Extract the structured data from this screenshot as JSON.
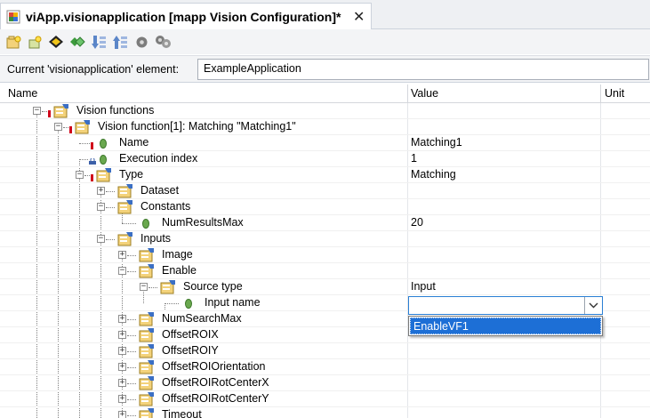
{
  "tab": {
    "title": "viApp.visionapplication [mapp Vision Configuration]*",
    "close_glyph": "✕"
  },
  "toolbar": {
    "buttons": [
      "add-element-icon",
      "add-child-icon",
      "move-icon",
      "link-icon",
      "sort-descending-icon",
      "sort-ascending-icon",
      "settings-icon",
      "multi-settings-icon"
    ]
  },
  "current_element": {
    "label": "Current 'visionapplication' element:",
    "value": "ExampleApplication"
  },
  "grid": {
    "columns": [
      "Name",
      "Value",
      "Unit"
    ],
    "rows": [
      {
        "name": "Vision functions",
        "value": ""
      },
      {
        "name": "Vision function[1]: Matching \"Matching1\"",
        "value": ""
      },
      {
        "name": "Name",
        "value": "Matching1"
      },
      {
        "name": "Execution index",
        "value": "1"
      },
      {
        "name": "Type",
        "value": "Matching"
      },
      {
        "name": "Dataset",
        "value": ""
      },
      {
        "name": "Constants",
        "value": ""
      },
      {
        "name": "NumResultsMax",
        "value": "20"
      },
      {
        "name": "Inputs",
        "value": ""
      },
      {
        "name": "Image",
        "value": ""
      },
      {
        "name": "Enable",
        "value": ""
      },
      {
        "name": "Source type",
        "value": "Input"
      },
      {
        "name": "Input name",
        "value": ""
      },
      {
        "name": "NumSearchMax",
        "value": ""
      },
      {
        "name": "OffsetROIX",
        "value": ""
      },
      {
        "name": "OffsetROIY",
        "value": ""
      },
      {
        "name": "OffsetROIOrientation",
        "value": ""
      },
      {
        "name": "OffsetROIRotCenterX",
        "value": ""
      },
      {
        "name": "OffsetROIRotCenterY",
        "value": ""
      },
      {
        "name": "Timeout",
        "value": ""
      }
    ]
  },
  "combo": {
    "value": "",
    "options": [
      "EnableVF1"
    ],
    "selected": "EnableVF1"
  },
  "colors": {
    "accent": "#1d6fd6",
    "required": "#d0021b",
    "param_dot": "#6aa84f",
    "folder": "#e8c15a"
  }
}
